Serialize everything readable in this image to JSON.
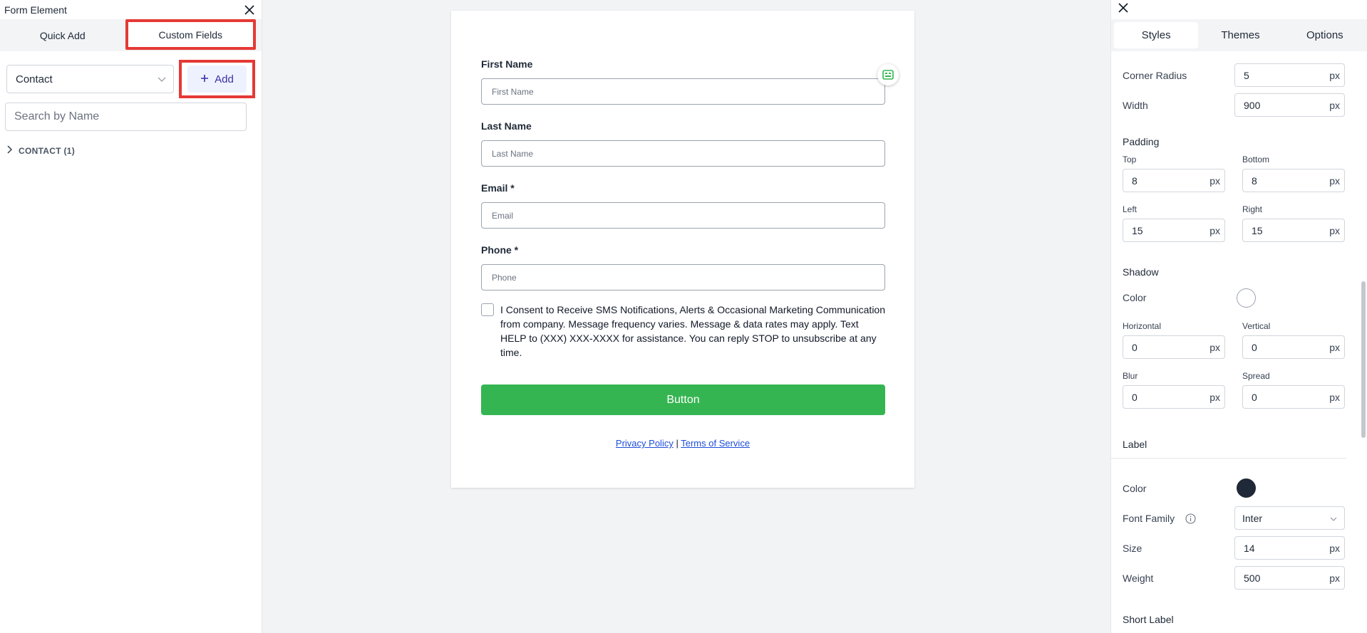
{
  "left_panel": {
    "title": "Form Element",
    "tabs": [
      "Quick Add",
      "Custom Fields"
    ],
    "object_select": "Contact",
    "add_label": "Add",
    "search_placeholder": "Search by Name",
    "group_label": "CONTACT (1)"
  },
  "form": {
    "fields": [
      {
        "label": "First Name",
        "placeholder": "First Name"
      },
      {
        "label": "Last Name",
        "placeholder": "Last Name"
      },
      {
        "label": "Email *",
        "placeholder": "Email"
      },
      {
        "label": "Phone *",
        "placeholder": "Phone"
      }
    ],
    "consent": "I Consent to Receive SMS Notifications, Alerts & Occasional Marketing Communication from company. Message frequency varies. Message & data rates may apply. Text HELP to (XXX) XXX-XXXX for assistance. You can reply STOP to unsubscribe at any time.",
    "submit": "Button",
    "privacy": "Privacy Policy",
    "separator": "|",
    "terms": "Terms of Service"
  },
  "right_panel": {
    "tabs": [
      "Styles",
      "Themes",
      "Options"
    ],
    "corner_radius_label": "Corner Radius",
    "corner_radius": "5",
    "width_label": "Width",
    "width": "900",
    "unit": "px",
    "padding_label": "Padding",
    "top_label": "Top",
    "top": "8",
    "bottom_label": "Bottom",
    "bottom": "8",
    "left_label": "Left",
    "left": "15",
    "right_label": "Right",
    "right": "15",
    "shadow_label": "Shadow",
    "color_label": "Color",
    "horizontal_label": "Horizontal",
    "horizontal": "0",
    "vertical_label": "Vertical",
    "vertical": "0",
    "blur_label": "Blur",
    "blur": "0",
    "spread_label": "Spread",
    "spread": "0",
    "label_section": "Label",
    "font_family_label": "Font Family",
    "font_family": "Inter",
    "size_label": "Size",
    "size": "14",
    "weight_label": "Weight",
    "weight": "500",
    "short_label": "Short Label"
  },
  "colors": {
    "accent_green": "#35b551",
    "highlight_red": "#e53935",
    "shadow_color": "#ffffff",
    "label_color": "#1f2937"
  }
}
